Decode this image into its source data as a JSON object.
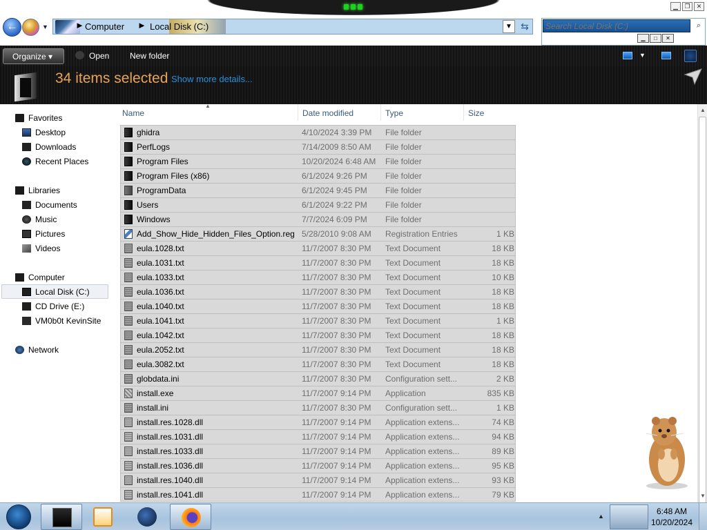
{
  "window": {
    "min_label": "▁",
    "max_label": "❐",
    "close_label": "✕"
  },
  "address": {
    "crumbs": [
      "Computer",
      "Local Disk (C:)"
    ],
    "separators": [
      "►",
      "►"
    ]
  },
  "search": {
    "placeholder": "Search Local Disk (C:)",
    "value": ""
  },
  "toolbar": {
    "organize_label": "Organize ▾",
    "open_label": "Open",
    "new_folder_label": "New folder"
  },
  "details": {
    "selection_text": "34 items selected",
    "show_more": "Show more details..."
  },
  "nav": {
    "favorites": {
      "label": "Favorites",
      "items": [
        "Desktop",
        "Downloads",
        "Recent Places"
      ]
    },
    "libraries": {
      "label": "Libraries",
      "items": [
        "Documents",
        "Music",
        "Pictures",
        "Videos"
      ]
    },
    "computer": {
      "label": "Computer",
      "items": [
        "Local Disk (C:)",
        "CD Drive (E:)",
        "VM0b0t KevinSite"
      ]
    },
    "network": {
      "label": "Network"
    }
  },
  "columns": {
    "name": "Name",
    "date": "Date modified",
    "type": "Type",
    "size": "Size"
  },
  "files": [
    {
      "name": "ghidra",
      "date": "4/10/2024 3:39 PM",
      "type": "File folder",
      "size": "",
      "icon": "folder"
    },
    {
      "name": "PerfLogs",
      "date": "7/14/2009 8:50 AM",
      "type": "File folder",
      "size": "",
      "icon": "folder"
    },
    {
      "name": "Program Files",
      "date": "10/20/2024 6:48 AM",
      "type": "File folder",
      "size": "",
      "icon": "folder"
    },
    {
      "name": "Program Files (x86)",
      "date": "6/1/2024 9:26 PM",
      "type": "File folder",
      "size": "",
      "icon": "folder"
    },
    {
      "name": "ProgramData",
      "date": "6/1/2024 9:45 PM",
      "type": "File folder",
      "size": "",
      "icon": "folder-light"
    },
    {
      "name": "Users",
      "date": "6/1/2024 9:22 PM",
      "type": "File folder",
      "size": "",
      "icon": "folder"
    },
    {
      "name": "Windows",
      "date": "7/7/2024 6:09 PM",
      "type": "File folder",
      "size": "",
      "icon": "folder"
    },
    {
      "name": "Add_Show_Hide_Hidden_Files_Option.reg",
      "date": "5/28/2010 9:08 AM",
      "type": "Registration Entries",
      "size": "1 KB",
      "icon": "reg"
    },
    {
      "name": "eula.1028.txt",
      "date": "11/7/2007 8:30 PM",
      "type": "Text Document",
      "size": "18 KB",
      "icon": "doc"
    },
    {
      "name": "eula.1031.txt",
      "date": "11/7/2007 8:30 PM",
      "type": "Text Document",
      "size": "18 KB",
      "icon": "doc"
    },
    {
      "name": "eula.1033.txt",
      "date": "11/7/2007 8:30 PM",
      "type": "Text Document",
      "size": "10 KB",
      "icon": "doc"
    },
    {
      "name": "eula.1036.txt",
      "date": "11/7/2007 8:30 PM",
      "type": "Text Document",
      "size": "18 KB",
      "icon": "doc"
    },
    {
      "name": "eula.1040.txt",
      "date": "11/7/2007 8:30 PM",
      "type": "Text Document",
      "size": "18 KB",
      "icon": "doc"
    },
    {
      "name": "eula.1041.txt",
      "date": "11/7/2007 8:30 PM",
      "type": "Text Document",
      "size": "1 KB",
      "icon": "doc"
    },
    {
      "name": "eula.1042.txt",
      "date": "11/7/2007 8:30 PM",
      "type": "Text Document",
      "size": "18 KB",
      "icon": "doc"
    },
    {
      "name": "eula.2052.txt",
      "date": "11/7/2007 8:30 PM",
      "type": "Text Document",
      "size": "18 KB",
      "icon": "doc"
    },
    {
      "name": "eula.3082.txt",
      "date": "11/7/2007 8:30 PM",
      "type": "Text Document",
      "size": "18 KB",
      "icon": "doc"
    },
    {
      "name": "globdata.ini",
      "date": "11/7/2007 8:30 PM",
      "type": "Configuration sett...",
      "size": "2 KB",
      "icon": "doc"
    },
    {
      "name": "install.exe",
      "date": "11/7/2007 9:14 PM",
      "type": "Application",
      "size": "835 KB",
      "icon": "exe"
    },
    {
      "name": "install.ini",
      "date": "11/7/2007 8:30 PM",
      "type": "Configuration sett...",
      "size": "1 KB",
      "icon": "doc"
    },
    {
      "name": "install.res.1028.dll",
      "date": "11/7/2007 9:14 PM",
      "type": "Application extens...",
      "size": "74 KB",
      "icon": "dll"
    },
    {
      "name": "install.res.1031.dll",
      "date": "11/7/2007 9:14 PM",
      "type": "Application extens...",
      "size": "94 KB",
      "icon": "dll"
    },
    {
      "name": "install.res.1033.dll",
      "date": "11/7/2007 9:14 PM",
      "type": "Application extens...",
      "size": "89 KB",
      "icon": "dll"
    },
    {
      "name": "install.res.1036.dll",
      "date": "11/7/2007 9:14 PM",
      "type": "Application extens...",
      "size": "95 KB",
      "icon": "dll"
    },
    {
      "name": "install.res.1040.dll",
      "date": "11/7/2007 9:14 PM",
      "type": "Application extens...",
      "size": "93 KB",
      "icon": "dll"
    },
    {
      "name": "install.res.1041.dll",
      "date": "11/7/2007 9:14 PM",
      "type": "Application extens...",
      "size": "79 KB",
      "icon": "dll"
    }
  ],
  "taskbar": {
    "time": "6:48 AM",
    "date": "10/20/2024"
  },
  "colors": {
    "selection_count": "#e8a35a",
    "link": "#2b8fd6",
    "row_selected": "#d9d9d9"
  }
}
